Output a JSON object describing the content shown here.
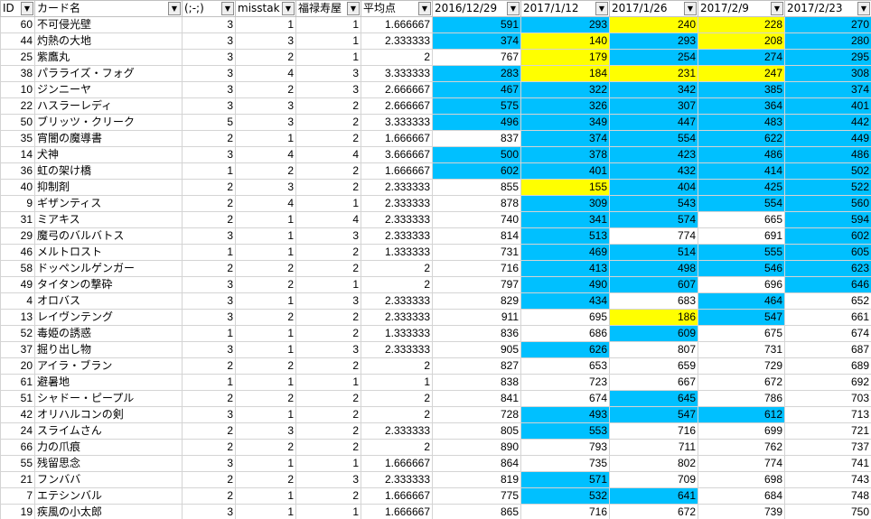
{
  "sheet": {
    "columns": [
      "ID",
      "カード名",
      "(;-;)",
      "misstak",
      "福禄寿屋",
      "平均点",
      "2016/12/29",
      "2017/1/12",
      "2017/1/26",
      "2017/2/9",
      "2017/2/23"
    ],
    "filter_icon": "dropdown-arrow-icon",
    "colors": {
      "blue": "#00c0ff",
      "yellow": "#ffff00"
    },
    "rows": [
      {
        "id": "60",
        "name": "不可侵光壁",
        "a": "3",
        "b": "1",
        "c": "1",
        "avg": "1.666667",
        "d": [
          "591",
          "293",
          "240",
          "228",
          "270"
        ],
        "hl": [
          "b",
          "b",
          "y",
          "y",
          "b"
        ]
      },
      {
        "id": "44",
        "name": "灼熱の大地",
        "a": "3",
        "b": "3",
        "c": "1",
        "avg": "2.333333",
        "d": [
          "374",
          "140",
          "293",
          "208",
          "280"
        ],
        "hl": [
          "b",
          "y",
          "b",
          "y",
          "b"
        ]
      },
      {
        "id": "25",
        "name": "紫鷹丸",
        "a": "3",
        "b": "2",
        "c": "1",
        "avg": "2",
        "d": [
          "767",
          "179",
          "254",
          "274",
          "295"
        ],
        "hl": [
          "n",
          "y",
          "b",
          "b",
          "b"
        ]
      },
      {
        "id": "38",
        "name": "パラライズ・フォグ",
        "a": "3",
        "b": "4",
        "c": "3",
        "avg": "3.333333",
        "d": [
          "283",
          "184",
          "231",
          "247",
          "308"
        ],
        "hl": [
          "b",
          "y",
          "y",
          "y",
          "b"
        ]
      },
      {
        "id": "10",
        "name": "ジンニーヤ",
        "a": "3",
        "b": "2",
        "c": "3",
        "avg": "2.666667",
        "d": [
          "467",
          "322",
          "342",
          "385",
          "374"
        ],
        "hl": [
          "b",
          "b",
          "b",
          "b",
          "b"
        ]
      },
      {
        "id": "22",
        "name": "ハスラーレディ",
        "a": "3",
        "b": "3",
        "c": "2",
        "avg": "2.666667",
        "d": [
          "575",
          "326",
          "307",
          "364",
          "401"
        ],
        "hl": [
          "b",
          "b",
          "b",
          "b",
          "b"
        ]
      },
      {
        "id": "50",
        "name": "ブリッツ・クリーク",
        "a": "5",
        "b": "3",
        "c": "2",
        "avg": "3.333333",
        "d": [
          "496",
          "349",
          "447",
          "483",
          "442"
        ],
        "hl": [
          "b",
          "b",
          "b",
          "b",
          "b"
        ]
      },
      {
        "id": "35",
        "name": "宵闇の魔導書",
        "a": "2",
        "b": "1",
        "c": "2",
        "avg": "1.666667",
        "d": [
          "837",
          "374",
          "554",
          "622",
          "449"
        ],
        "hl": [
          "n",
          "b",
          "b",
          "b",
          "b"
        ]
      },
      {
        "id": "14",
        "name": "犬神",
        "a": "3",
        "b": "4",
        "c": "4",
        "avg": "3.666667",
        "d": [
          "500",
          "378",
          "423",
          "486",
          "486"
        ],
        "hl": [
          "b",
          "b",
          "b",
          "b",
          "b"
        ]
      },
      {
        "id": "36",
        "name": "虹の架け橋",
        "a": "1",
        "b": "2",
        "c": "2",
        "avg": "1.666667",
        "d": [
          "602",
          "401",
          "432",
          "414",
          "502"
        ],
        "hl": [
          "b",
          "b",
          "b",
          "b",
          "b"
        ]
      },
      {
        "id": "40",
        "name": "抑制剤",
        "a": "2",
        "b": "3",
        "c": "2",
        "avg": "2.333333",
        "d": [
          "855",
          "155",
          "404",
          "425",
          "522"
        ],
        "hl": [
          "n",
          "y",
          "b",
          "b",
          "b"
        ]
      },
      {
        "id": "9",
        "name": "ギザンティス",
        "a": "2",
        "b": "4",
        "c": "1",
        "avg": "2.333333",
        "d": [
          "878",
          "309",
          "543",
          "554",
          "560"
        ],
        "hl": [
          "n",
          "b",
          "b",
          "b",
          "b"
        ]
      },
      {
        "id": "31",
        "name": "ミアキス",
        "a": "2",
        "b": "1",
        "c": "4",
        "avg": "2.333333",
        "d": [
          "740",
          "341",
          "574",
          "665",
          "594"
        ],
        "hl": [
          "n",
          "b",
          "b",
          "n",
          "b"
        ]
      },
      {
        "id": "29",
        "name": "魔弓のバルバトス",
        "a": "3",
        "b": "1",
        "c": "3",
        "avg": "2.333333",
        "d": [
          "814",
          "513",
          "774",
          "691",
          "602"
        ],
        "hl": [
          "n",
          "b",
          "n",
          "n",
          "b"
        ]
      },
      {
        "id": "46",
        "name": "メルトロスト",
        "a": "1",
        "b": "1",
        "c": "2",
        "avg": "1.333333",
        "d": [
          "731",
          "469",
          "514",
          "555",
          "605"
        ],
        "hl": [
          "n",
          "b",
          "b",
          "b",
          "b"
        ]
      },
      {
        "id": "58",
        "name": "ドッペンルゲンガー",
        "a": "2",
        "b": "2",
        "c": "2",
        "avg": "2",
        "d": [
          "716",
          "413",
          "498",
          "546",
          "623"
        ],
        "hl": [
          "n",
          "b",
          "b",
          "b",
          "b"
        ]
      },
      {
        "id": "49",
        "name": "タイタンの撃砕",
        "a": "3",
        "b": "2",
        "c": "1",
        "avg": "2",
        "d": [
          "797",
          "490",
          "607",
          "696",
          "646"
        ],
        "hl": [
          "n",
          "b",
          "b",
          "n",
          "b"
        ]
      },
      {
        "id": "4",
        "name": "オロバス",
        "a": "3",
        "b": "1",
        "c": "3",
        "avg": "2.333333",
        "d": [
          "829",
          "434",
          "683",
          "464",
          "652"
        ],
        "hl": [
          "n",
          "b",
          "n",
          "b",
          "n"
        ]
      },
      {
        "id": "13",
        "name": "レイヴンテング",
        "a": "3",
        "b": "2",
        "c": "2",
        "avg": "2.333333",
        "d": [
          "911",
          "695",
          "186",
          "547",
          "661"
        ],
        "hl": [
          "n",
          "n",
          "y",
          "b",
          "n"
        ]
      },
      {
        "id": "52",
        "name": "毒姫の誘惑",
        "a": "1",
        "b": "1",
        "c": "2",
        "avg": "1.333333",
        "d": [
          "836",
          "686",
          "609",
          "675",
          "674"
        ],
        "hl": [
          "n",
          "n",
          "b",
          "n",
          "n"
        ]
      },
      {
        "id": "37",
        "name": "掘り出し物",
        "a": "3",
        "b": "1",
        "c": "3",
        "avg": "2.333333",
        "d": [
          "905",
          "626",
          "807",
          "731",
          "687"
        ],
        "hl": [
          "n",
          "b",
          "n",
          "n",
          "n"
        ]
      },
      {
        "id": "20",
        "name": "アイラ・ブラン",
        "a": "2",
        "b": "2",
        "c": "2",
        "avg": "2",
        "d": [
          "827",
          "653",
          "659",
          "729",
          "689"
        ],
        "hl": [
          "n",
          "n",
          "n",
          "n",
          "n"
        ]
      },
      {
        "id": "61",
        "name": "避暑地",
        "a": "1",
        "b": "1",
        "c": "1",
        "avg": "1",
        "d": [
          "838",
          "723",
          "667",
          "672",
          "692"
        ],
        "hl": [
          "n",
          "n",
          "n",
          "n",
          "n"
        ]
      },
      {
        "id": "51",
        "name": "シャドー・ピープル",
        "a": "2",
        "b": "2",
        "c": "2",
        "avg": "2",
        "d": [
          "841",
          "674",
          "645",
          "786",
          "703"
        ],
        "hl": [
          "n",
          "n",
          "b",
          "n",
          "n"
        ]
      },
      {
        "id": "42",
        "name": "オリハルコンの剣",
        "a": "3",
        "b": "1",
        "c": "2",
        "avg": "2",
        "d": [
          "728",
          "493",
          "547",
          "612",
          "713"
        ],
        "hl": [
          "n",
          "b",
          "b",
          "b",
          "n"
        ]
      },
      {
        "id": "24",
        "name": "スライムさん",
        "a": "2",
        "b": "3",
        "c": "2",
        "avg": "2.333333",
        "d": [
          "805",
          "553",
          "716",
          "699",
          "721"
        ],
        "hl": [
          "n",
          "b",
          "n",
          "n",
          "n"
        ]
      },
      {
        "id": "66",
        "name": "力の爪痕",
        "a": "2",
        "b": "2",
        "c": "2",
        "avg": "2",
        "d": [
          "890",
          "793",
          "711",
          "762",
          "737"
        ],
        "hl": [
          "n",
          "n",
          "n",
          "n",
          "n"
        ]
      },
      {
        "id": "55",
        "name": "残留思念",
        "a": "3",
        "b": "1",
        "c": "1",
        "avg": "1.666667",
        "d": [
          "864",
          "735",
          "802",
          "774",
          "741"
        ],
        "hl": [
          "n",
          "n",
          "n",
          "n",
          "n"
        ]
      },
      {
        "id": "21",
        "name": "フンババ",
        "a": "2",
        "b": "2",
        "c": "3",
        "avg": "2.333333",
        "d": [
          "819",
          "571",
          "709",
          "698",
          "743"
        ],
        "hl": [
          "n",
          "b",
          "n",
          "n",
          "n"
        ]
      },
      {
        "id": "7",
        "name": "エテシンバル",
        "a": "2",
        "b": "1",
        "c": "2",
        "avg": "1.666667",
        "d": [
          "775",
          "532",
          "641",
          "684",
          "748"
        ],
        "hl": [
          "n",
          "b",
          "b",
          "n",
          "n"
        ]
      },
      {
        "id": "19",
        "name": "疾風の小太郎",
        "a": "3",
        "b": "1",
        "c": "1",
        "avg": "1.666667",
        "d": [
          "865",
          "716",
          "672",
          "739",
          "750"
        ],
        "hl": [
          "n",
          "n",
          "n",
          "n",
          "n"
        ]
      }
    ]
  }
}
